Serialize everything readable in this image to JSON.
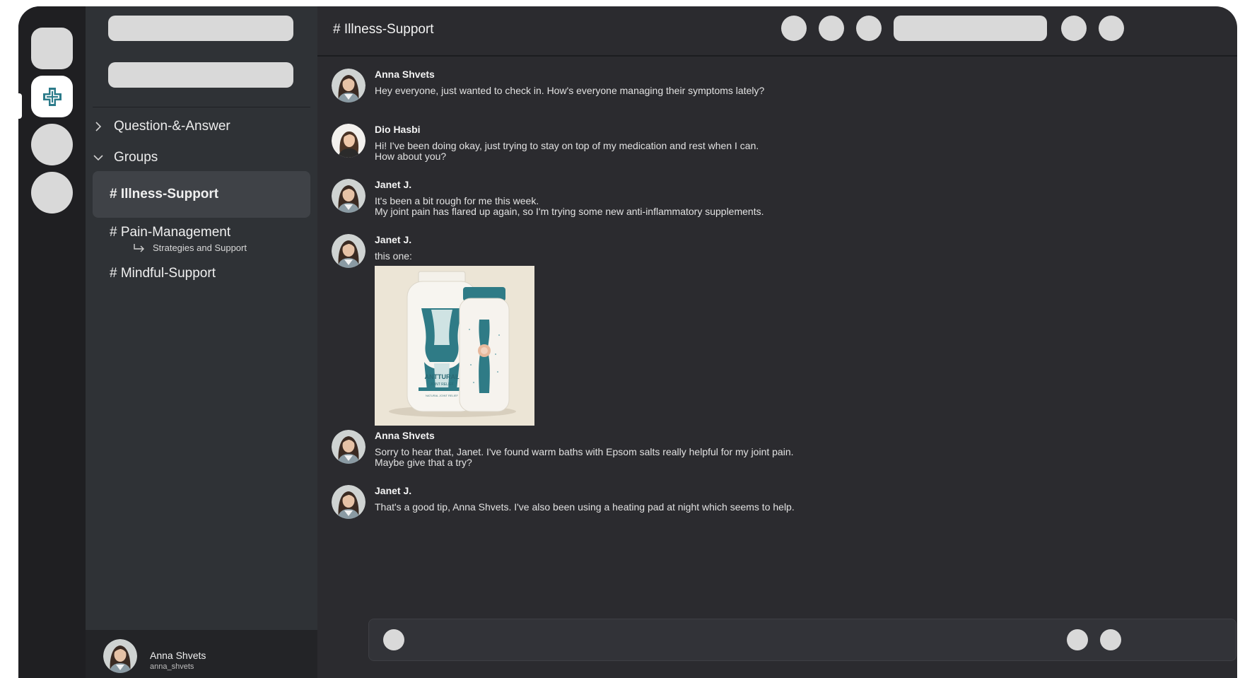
{
  "rail": {
    "items": [
      "server-placeholder",
      "health-app-server",
      "server-placeholder",
      "server-placeholder"
    ],
    "active_icon": "medical-cross-icon"
  },
  "sidebar": {
    "categories": [
      {
        "label": "Question-&-Answer",
        "expanded": false
      },
      {
        "label": "Groups",
        "expanded": true
      }
    ],
    "channels": [
      {
        "label": "# Illness-Support",
        "active": true
      },
      {
        "label": "# Pain-Management",
        "active": false
      },
      {
        "label": "# Mindful-Support",
        "active": false
      }
    ],
    "thread": {
      "label": "Strategies and Support"
    }
  },
  "user": {
    "name": "Anna Shvets",
    "handle": "anna_shvets"
  },
  "header": {
    "channel_title": "# Illness-Support"
  },
  "messages": [
    {
      "author": "Anna Shvets",
      "lines": [
        "Hey everyone, just wanted to check in. How's everyone managing their symptoms lately?"
      ]
    },
    {
      "author": "Dio Hasbi",
      "lines": [
        "Hi! I've been doing okay, just trying to stay on top of my medication and rest when I can.",
        "How about you?"
      ]
    },
    {
      "author": "Janet J.",
      "lines": [
        "It's been a bit rough for me this week.",
        "My joint pain has flared up again, so I'm trying some new anti-inflammatory supplements."
      ]
    },
    {
      "author": "Janet J.",
      "lines": [
        "this one:"
      ],
      "attachment": {
        "brand": "ANTTURAL",
        "line1": "JOINT RELIEF",
        "line2": "NATURAL JOINT RELIEF"
      }
    },
    {
      "author": "Anna Shvets",
      "lines": [
        "Sorry to hear that, Janet. I've found warm baths with Epsom salts really helpful for my joint pain.",
        "Maybe give that a try?"
      ]
    },
    {
      "author": "Janet J.",
      "lines": [
        "That's a good tip, Anna Shvets. I've also been using a heating pad at night which seems to help."
      ]
    }
  ],
  "colors": {
    "app_bg": "#2b2b2f",
    "rail_bg": "#1f1f22",
    "sidebar_bg": "#2f3236",
    "active_channel": "#3f4247",
    "placeholder": "#d9d9d9",
    "accent_teal": "#2c7b8a"
  }
}
